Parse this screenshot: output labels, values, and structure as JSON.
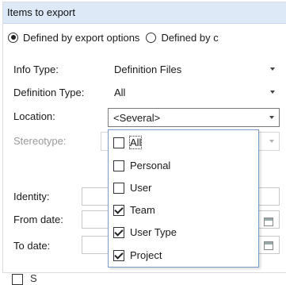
{
  "group": {
    "title": "Items to export"
  },
  "radios": [
    {
      "label": "Defined by export options",
      "checked": true
    },
    {
      "label": "Defined by c",
      "checked": false
    }
  ],
  "fields": {
    "info_type": {
      "label": "Info Type:",
      "value": "Definition Files"
    },
    "definition_type": {
      "label": "Definition Type:",
      "value": "All"
    },
    "location": {
      "label": "Location:",
      "value": "<Several>"
    },
    "stereotype": {
      "label": "Stereotype:",
      "value": ""
    },
    "identity": {
      "label": "Identity:",
      "value": ""
    },
    "from_date": {
      "label": "From date:",
      "value": ""
    },
    "to_date": {
      "label": "To date:",
      "value": ""
    }
  },
  "location_dropdown": {
    "items": [
      {
        "label": "All",
        "checked": false
      },
      {
        "label": "Personal",
        "checked": false
      },
      {
        "label": "User",
        "checked": false
      },
      {
        "label": "Team",
        "checked": true
      },
      {
        "label": "User Type",
        "checked": true
      },
      {
        "label": "Project",
        "checked": true
      }
    ]
  },
  "bottom": {
    "label": "S"
  }
}
